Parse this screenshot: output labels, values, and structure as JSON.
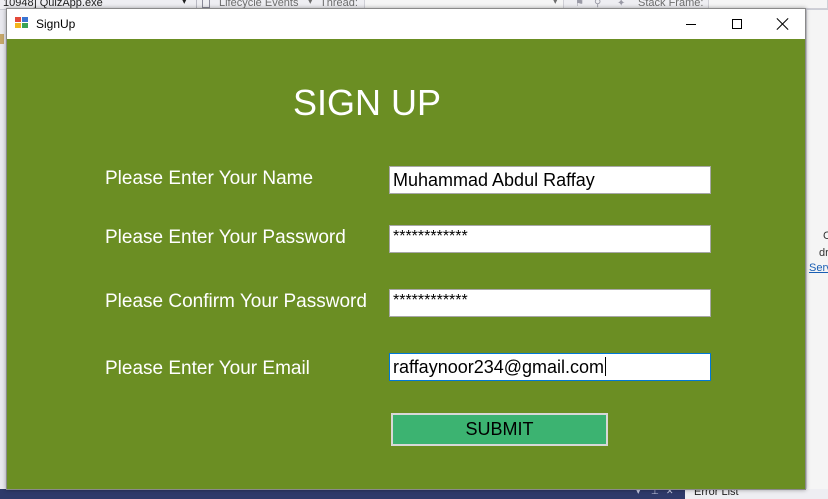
{
  "ide": {
    "process": "10948] QuizApp.exe",
    "lifecycle": "Lifecycle Events",
    "thread_label": "Thread:",
    "stack_label": "Stack Frame:",
    "side_text_1": "C",
    "side_text_2": "dr",
    "side_link": "Serv",
    "error_list": "Error List"
  },
  "window": {
    "title": "SignUp"
  },
  "form": {
    "heading": "SIGN UP",
    "name_label": "Please Enter Your Name",
    "name_value": "Muhammad Abdul Raffay",
    "password_label": "Please Enter Your Password",
    "password_value": "************",
    "confirm_label": "Please Confirm Your Password",
    "confirm_value": "************",
    "email_label": "Please Enter Your Email",
    "email_value": "raffaynoor234@gmail.com",
    "submit_label": "SUBMIT"
  },
  "colors": {
    "form_background": "#6b8e23",
    "submit_background": "#3cb371",
    "text_on_form": "#ffffff"
  }
}
